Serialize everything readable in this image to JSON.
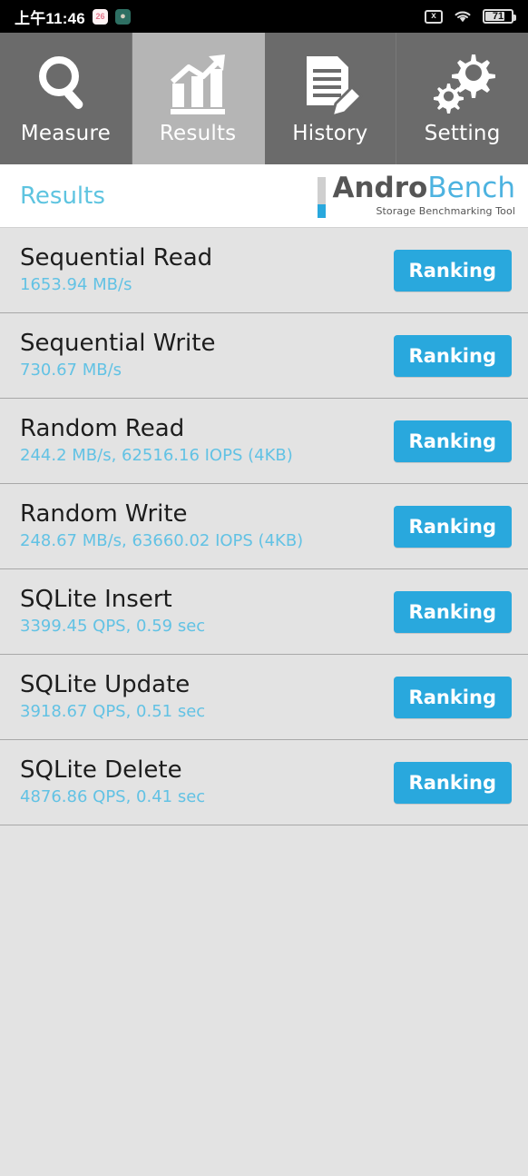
{
  "statusbar": {
    "clock": "上午11:46",
    "notifications": [
      {
        "icon": "calendar-icon",
        "label": "26"
      },
      {
        "icon": "app-icon",
        "label": ""
      }
    ],
    "no_sim_icon": "x",
    "wifi_icon": "wifi-icon",
    "battery_percent": "71",
    "battery_level": 71
  },
  "tabs": [
    {
      "label": "Measure",
      "icon": "magnifier-icon",
      "active": false
    },
    {
      "label": "Results",
      "icon": "bar-chart-icon",
      "active": true
    },
    {
      "label": "History",
      "icon": "document-pencil-icon",
      "active": false
    },
    {
      "label": "Setting",
      "icon": "gears-icon",
      "active": false
    }
  ],
  "header": {
    "title": "Results",
    "logo_primary": "Andro",
    "logo_secondary": "Bench",
    "logo_tagline": "Storage Benchmarking Tool"
  },
  "results": [
    {
      "title": "Sequential Read",
      "value": "1653.94 MB/s",
      "button": "Ranking"
    },
    {
      "title": "Sequential Write",
      "value": "730.67 MB/s",
      "button": "Ranking"
    },
    {
      "title": "Random Read",
      "value": "244.2 MB/s, 62516.16 IOPS (4KB)",
      "button": "Ranking"
    },
    {
      "title": "Random Write",
      "value": "248.67 MB/s, 63660.02 IOPS (4KB)",
      "button": "Ranking"
    },
    {
      "title": "SQLite Insert",
      "value": "3399.45 QPS, 0.59 sec",
      "button": "Ranking"
    },
    {
      "title": "SQLite Update",
      "value": "3918.67 QPS, 0.51 sec",
      "button": "Ranking"
    },
    {
      "title": "SQLite Delete",
      "value": "4876.86 QPS, 0.41 sec",
      "button": "Ranking"
    }
  ],
  "colors": {
    "accent_blue": "#29a8dd",
    "value_blue": "#62c2e4",
    "title_blue": "#5ec4e0",
    "list_bg": "#e3e3e3",
    "tab_inactive": "#6b6b6b",
    "tab_active": "#b5b5b5"
  }
}
